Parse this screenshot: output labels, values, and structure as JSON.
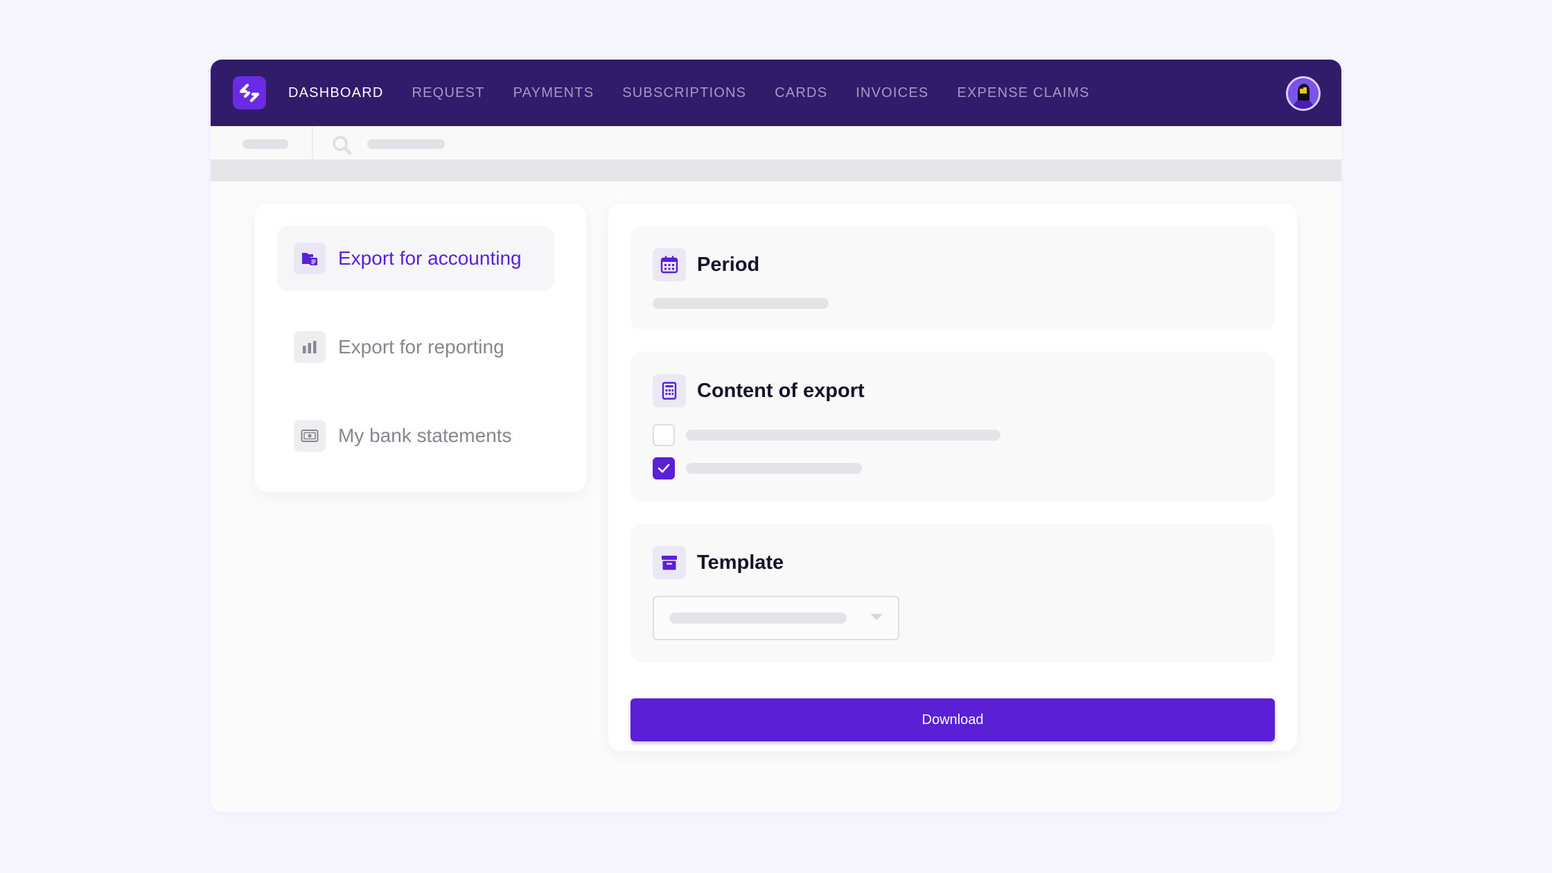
{
  "nav": {
    "items": [
      {
        "label": "DASHBOARD",
        "active": true
      },
      {
        "label": "REQUEST"
      },
      {
        "label": "PAYMENTS"
      },
      {
        "label": "SUBSCRIPTIONS"
      },
      {
        "label": "CARDS"
      },
      {
        "label": "INVOICES"
      },
      {
        "label": "EXPENSE CLAIMS"
      }
    ]
  },
  "sidebar": {
    "items": [
      {
        "label": "Export for accounting",
        "icon": "folder-document-icon",
        "active": true
      },
      {
        "label": "Export for reporting",
        "icon": "bar-chart-icon"
      },
      {
        "label": "My bank statements",
        "icon": "banknote-icon"
      }
    ]
  },
  "export": {
    "period": {
      "title": "Period",
      "icon": "calendar-icon"
    },
    "content": {
      "title": "Content of export",
      "icon": "spreadsheet-icon",
      "options": [
        {
          "checked": false
        },
        {
          "checked": true
        }
      ]
    },
    "template": {
      "title": "Template",
      "icon": "archive-box-icon"
    },
    "download_label": "Download"
  },
  "colors": {
    "nav_bg": "#301c6b",
    "accent": "#5b1fd6",
    "page_bg": "#f6f4fd"
  }
}
